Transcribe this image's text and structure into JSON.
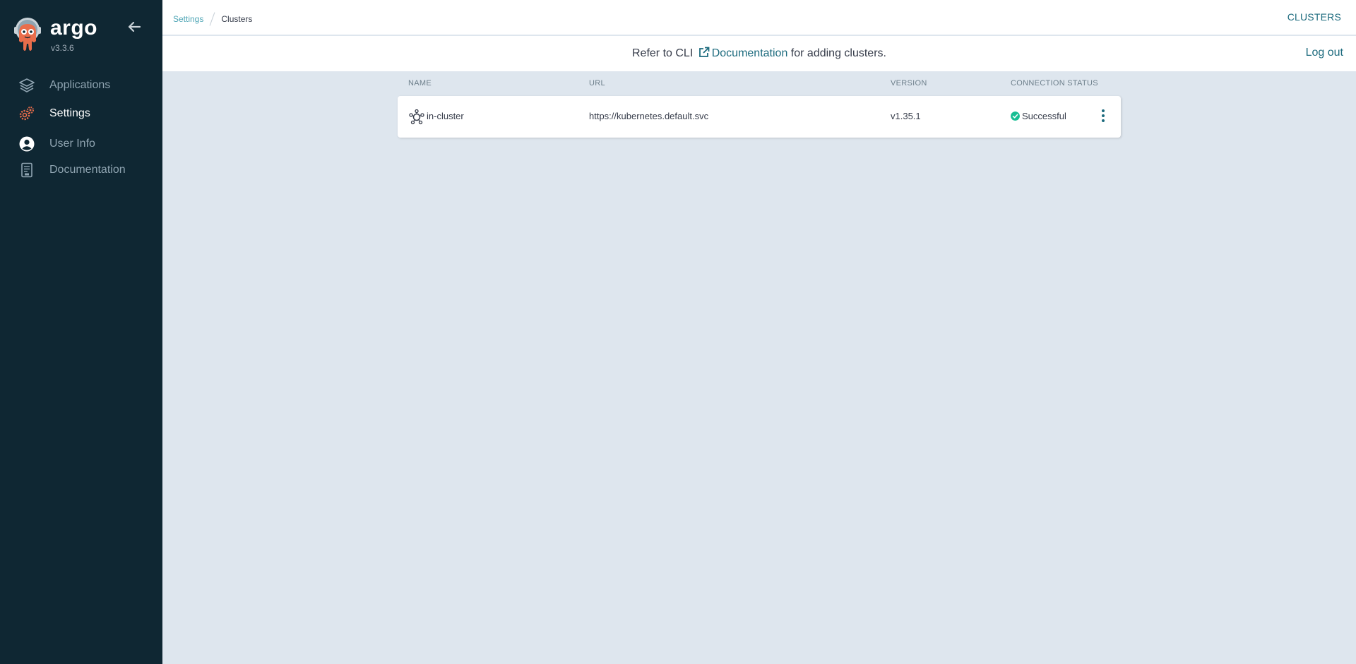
{
  "app": {
    "brand": "argo",
    "version": "v3.3.6"
  },
  "sidebar": {
    "items": [
      {
        "label": "Applications",
        "icon": "layers-icon",
        "active": false
      },
      {
        "label": "Settings",
        "icon": "gears-icon",
        "active": true
      },
      {
        "label": "User Info",
        "icon": "user-circle-icon",
        "active": false
      },
      {
        "label": "Documentation",
        "icon": "book-icon",
        "active": false
      }
    ]
  },
  "header": {
    "breadcrumb": [
      "Settings",
      "Clusters"
    ],
    "title": "CLUSTERS",
    "logout": "Log out",
    "info_prefix": "Refer to CLI",
    "info_link": "Documentation",
    "info_suffix": "for adding clusters."
  },
  "table": {
    "columns": [
      "NAME",
      "URL",
      "VERSION",
      "CONNECTION STATUS"
    ],
    "rows": [
      {
        "name": "in-cluster",
        "url": "https://kubernetes.default.svc",
        "version": "v1.35.1",
        "status": "Successful"
      }
    ]
  },
  "colors": {
    "sidebar_bg": "#0f2733",
    "accent": "#1d6b7e",
    "link": "#4ea5b5",
    "success": "#18be94",
    "logo_orange": "#e96d4b"
  }
}
